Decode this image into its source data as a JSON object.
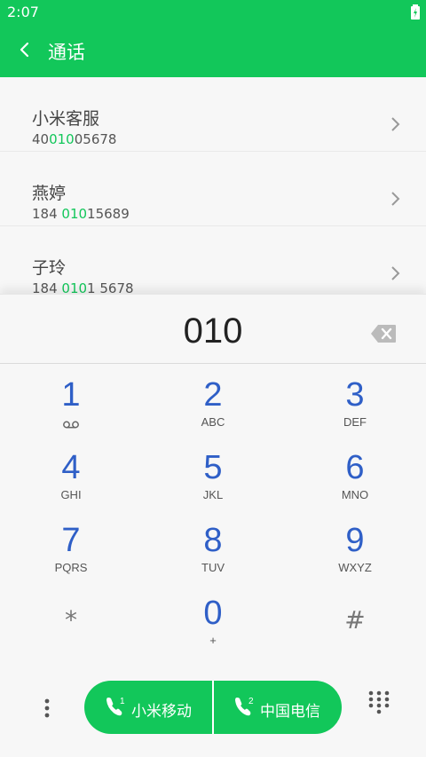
{
  "status": {
    "time": "2:07"
  },
  "header": {
    "title": "通话"
  },
  "contacts": [
    {
      "name": "小米客服",
      "num_pre": "40",
      "num_hl": "010",
      "num_post": "05678"
    },
    {
      "name": "燕婷",
      "num_pre": "184 ",
      "num_hl": "010",
      "num_post": "15689"
    },
    {
      "name": "子玲",
      "num_pre": "184 ",
      "num_hl": "010",
      "num_post": "1 5678"
    }
  ],
  "dial": {
    "input": "010"
  },
  "keys": [
    {
      "digit": "1",
      "letters": ""
    },
    {
      "digit": "2",
      "letters": "ABC"
    },
    {
      "digit": "3",
      "letters": "DEF"
    },
    {
      "digit": "4",
      "letters": "GHI"
    },
    {
      "digit": "5",
      "letters": "JKL"
    },
    {
      "digit": "6",
      "letters": "MNO"
    },
    {
      "digit": "7",
      "letters": "PQRS"
    },
    {
      "digit": "8",
      "letters": "TUV"
    },
    {
      "digit": "9",
      "letters": "WXYZ"
    },
    {
      "digit": "*",
      "letters": ""
    },
    {
      "digit": "0",
      "letters": "+"
    },
    {
      "digit": "#",
      "letters": ""
    }
  ],
  "call": {
    "sim1_label": "小米移动",
    "sim2_label": "中国电信",
    "sim1_num": "1",
    "sim2_num": "2"
  },
  "colors": {
    "accent": "#12c75a",
    "digit": "#2f5fc7"
  }
}
